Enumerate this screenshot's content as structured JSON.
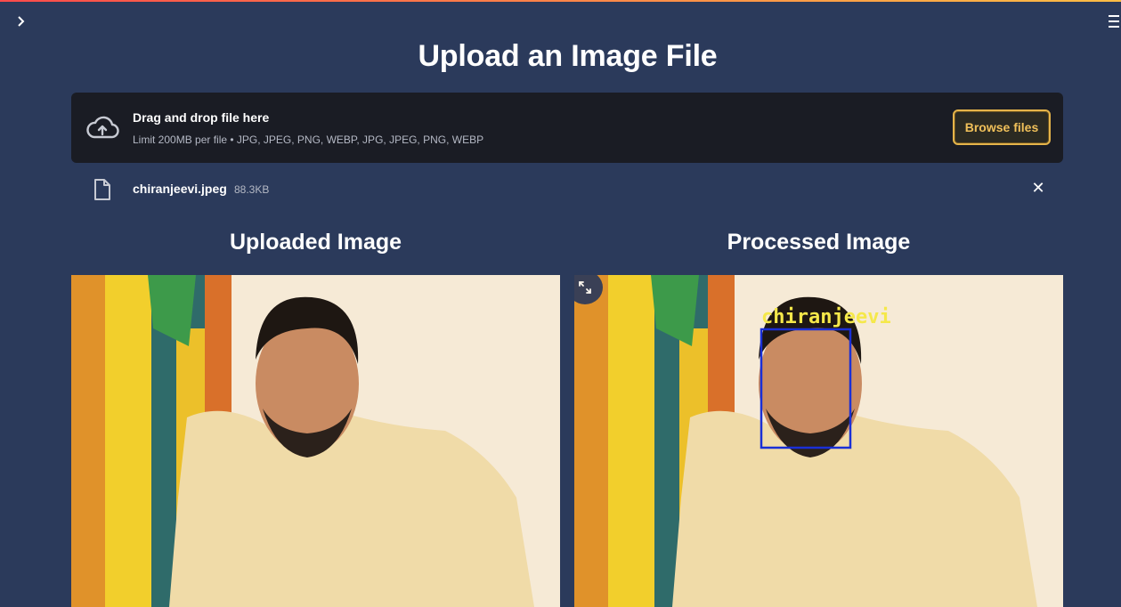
{
  "app": {
    "sidebar_toggle_icon": "chevron-right-icon",
    "menu_icon": "hamburger-menu-icon",
    "accent_colors": {
      "primary": "#ff4b4b",
      "secondary": "#ffbd45",
      "background": "#2b3a5b",
      "dropzone": "#1a1c24"
    }
  },
  "page": {
    "title": "Upload an Image File"
  },
  "uploader": {
    "drag_text": "Drag and drop file here",
    "limit_text": "Limit 200MB per file • JPG, JPEG, PNG, WEBP, JPG, JPEG, PNG, WEBP",
    "browse_label": "Browse files",
    "upload_icon": "cloud-upload-icon"
  },
  "file": {
    "name": "chiranjeevi.jpeg",
    "size": "88.3KB",
    "icon": "file-icon",
    "remove_icon": "close-icon",
    "remove_symbol": "✕"
  },
  "columns": {
    "uploaded_title": "Uploaded Image",
    "processed_title": "Processed Image"
  },
  "detection": {
    "label": "chiranjeevi",
    "label_color": "#f5e84a",
    "box_color": "#1a2fd6"
  },
  "fullscreen_icon": "expand-icon"
}
